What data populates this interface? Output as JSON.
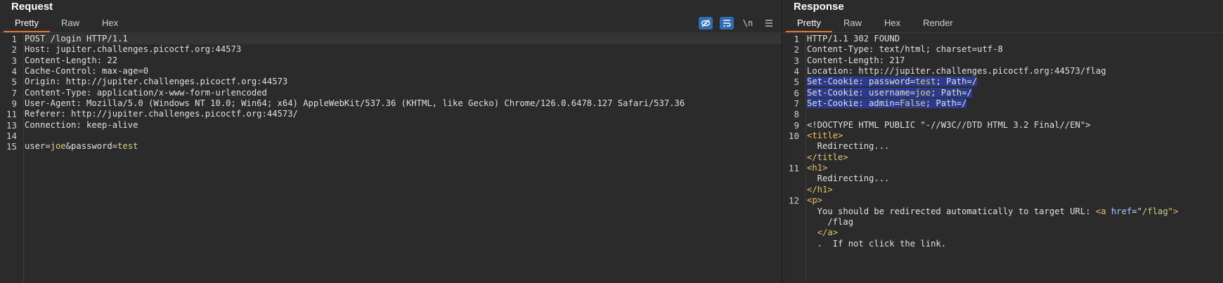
{
  "request": {
    "title": "Request",
    "tabs": [
      "Pretty",
      "Raw",
      "Hex"
    ],
    "active_tab": "Pretty",
    "tools": {
      "newline_label": "\\n"
    },
    "lines": [
      {
        "n": "1",
        "text": "POST /login HTTP/1.1"
      },
      {
        "n": "2",
        "text": "Host: jupiter.challenges.picoctf.org:44573"
      },
      {
        "n": "3",
        "text": "Content-Length: 22"
      },
      {
        "n": "4",
        "text": "Cache-Control: max-age=0"
      },
      {
        "n": "5",
        "text": "Origin: http://jupiter.challenges.picoctf.org:44573"
      },
      {
        "n": "7",
        "text": "Content-Type: application/x-www-form-urlencoded"
      },
      {
        "n": "9",
        "text": "User-Agent: Mozilla/5.0 (Windows NT 10.0; Win64; x64) AppleWebKit/537.36 (KHTML, like Gecko) Chrome/126.0.6478.127 Safari/537.36"
      },
      {
        "n": "11",
        "text": "Referer: http://jupiter.challenges.picoctf.org:44573/"
      },
      {
        "n": "13",
        "text": "Connection: keep-alive"
      },
      {
        "n": "14",
        "text": ""
      },
      {
        "n": "15",
        "parts": [
          {
            "t": "user="
          },
          {
            "t": "joe",
            "c": "val"
          },
          {
            "t": "&password="
          },
          {
            "t": "test",
            "c": "val"
          }
        ]
      }
    ]
  },
  "response": {
    "title": "Response",
    "tabs": [
      "Pretty",
      "Raw",
      "Hex",
      "Render"
    ],
    "active_tab": "Pretty",
    "lines": [
      {
        "n": "1",
        "text": "HTTP/1.1 302 FOUND"
      },
      {
        "n": "2",
        "text": "Content-Type: text/html; charset=utf-8"
      },
      {
        "n": "3",
        "text": "Content-Length: 217"
      },
      {
        "n": "4",
        "text": "Location: http://jupiter.challenges.picoctf.org:44573/flag"
      },
      {
        "n": "5",
        "hl": true,
        "parts": [
          {
            "t": "Set-Cookie: password="
          },
          {
            "t": "test",
            "c": "val"
          },
          {
            "t": "; Path=/"
          }
        ]
      },
      {
        "n": "6",
        "hl": true,
        "parts": [
          {
            "t": "Set-Cookie: username="
          },
          {
            "t": "joe",
            "c": "val"
          },
          {
            "t": "; Path=/"
          }
        ]
      },
      {
        "n": "7",
        "hl": true,
        "parts": [
          {
            "t": "Set-Cookie: admin="
          },
          {
            "t": "False",
            "c": "val"
          },
          {
            "t": "; Path=/"
          }
        ]
      },
      {
        "n": "8",
        "text": ""
      },
      {
        "n": "9",
        "text": "<!DOCTYPE HTML PUBLIC \"-//W3C//DTD HTML 3.2 Final//EN\">"
      },
      {
        "n": "10",
        "parts": [
          {
            "t": "<title>",
            "c": "tag"
          }
        ]
      },
      {
        "n": "",
        "text": "  Redirecting..."
      },
      {
        "n": "",
        "parts": [
          {
            "t": "</title>",
            "c": "tag"
          }
        ]
      },
      {
        "n": "11",
        "parts": [
          {
            "t": "<h1>",
            "c": "tag"
          }
        ]
      },
      {
        "n": "",
        "text": "  Redirecting..."
      },
      {
        "n": "",
        "parts": [
          {
            "t": "</h1>",
            "c": "tag"
          }
        ]
      },
      {
        "n": "12",
        "parts": [
          {
            "t": "<p>",
            "c": "tag"
          }
        ]
      },
      {
        "n": "",
        "parts": [
          {
            "t": "  You should be redirected automatically to target URL: "
          },
          {
            "t": "<a ",
            "c": "tag"
          },
          {
            "t": "href",
            "c": "attr"
          },
          {
            "t": "=\""
          },
          {
            "t": "/flag",
            "c": "str"
          },
          {
            "t": "\">",
            "c": "tag"
          }
        ]
      },
      {
        "n": "",
        "text": "    /flag"
      },
      {
        "n": "",
        "parts": [
          {
            "t": "  "
          },
          {
            "t": "</a>",
            "c": "tag"
          }
        ]
      },
      {
        "n": "",
        "text": "  .  If not click the link."
      }
    ]
  }
}
